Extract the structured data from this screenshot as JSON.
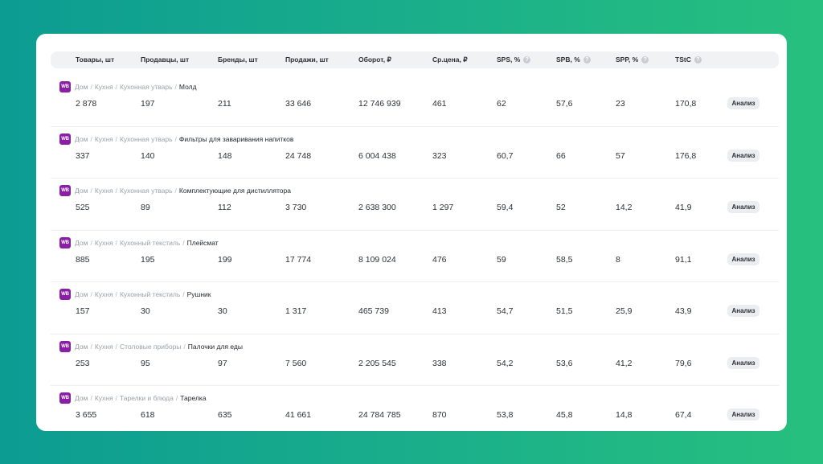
{
  "table": {
    "headers": [
      {
        "label": "Товары, шт",
        "info": false
      },
      {
        "label": "Продавцы, шт",
        "info": false
      },
      {
        "label": "Бренды, шт",
        "info": false
      },
      {
        "label": "Продажи, шт",
        "info": false
      },
      {
        "label": "Оборот, ₽",
        "info": false
      },
      {
        "label": "Ср.цена, ₽",
        "info": false
      },
      {
        "label": "SPS, %",
        "info": true
      },
      {
        "label": "SPB, %",
        "info": true
      },
      {
        "label": "SPP, %",
        "info": true
      },
      {
        "label": "TStC",
        "info": true
      }
    ],
    "info_glyph": "?",
    "marketplace_logo": "WB",
    "action_label": "Анализ",
    "rows": [
      {
        "path": [
          "Дом",
          "Кухня",
          "Кухонная утварь"
        ],
        "category": "Молд",
        "values": [
          "2 878",
          "197",
          "211",
          "33 646",
          "12 746 939",
          "461",
          "62",
          "57,6",
          "23",
          "170,8"
        ]
      },
      {
        "path": [
          "Дом",
          "Кухня",
          "Кухонная утварь"
        ],
        "category": "Фильтры для заваривания напитков",
        "values": [
          "337",
          "140",
          "148",
          "24 748",
          "6 004 438",
          "323",
          "60,7",
          "66",
          "57",
          "176,8"
        ]
      },
      {
        "path": [
          "Дом",
          "Кухня",
          "Кухонная утварь"
        ],
        "category": "Комплектующие для дистиллятора",
        "values": [
          "525",
          "89",
          "112",
          "3 730",
          "2 638 300",
          "1 297",
          "59,4",
          "52",
          "14,2",
          "41,9"
        ]
      },
      {
        "path": [
          "Дом",
          "Кухня",
          "Кухонный текстиль"
        ],
        "category": "Плейсмат",
        "values": [
          "885",
          "195",
          "199",
          "17 774",
          "8 109 024",
          "476",
          "59",
          "58,5",
          "8",
          "91,1"
        ]
      },
      {
        "path": [
          "Дом",
          "Кухня",
          "Кухонный текстиль"
        ],
        "category": "Рушник",
        "values": [
          "157",
          "30",
          "30",
          "1 317",
          "465 739",
          "413",
          "54,7",
          "51,5",
          "25,9",
          "43,9"
        ]
      },
      {
        "path": [
          "Дом",
          "Кухня",
          "Столовые приборы"
        ],
        "category": "Палочки для еды",
        "values": [
          "253",
          "95",
          "97",
          "7 560",
          "2 205 545",
          "338",
          "54,2",
          "53,6",
          "41,2",
          "79,6"
        ]
      },
      {
        "path": [
          "Дом",
          "Кухня",
          "Тарелки и блюда"
        ],
        "category": "Тарелка",
        "values": [
          "3 655",
          "618",
          "635",
          "41 661",
          "24 784 785",
          "870",
          "53,8",
          "45,8",
          "14,8",
          "67,4"
        ]
      }
    ]
  }
}
